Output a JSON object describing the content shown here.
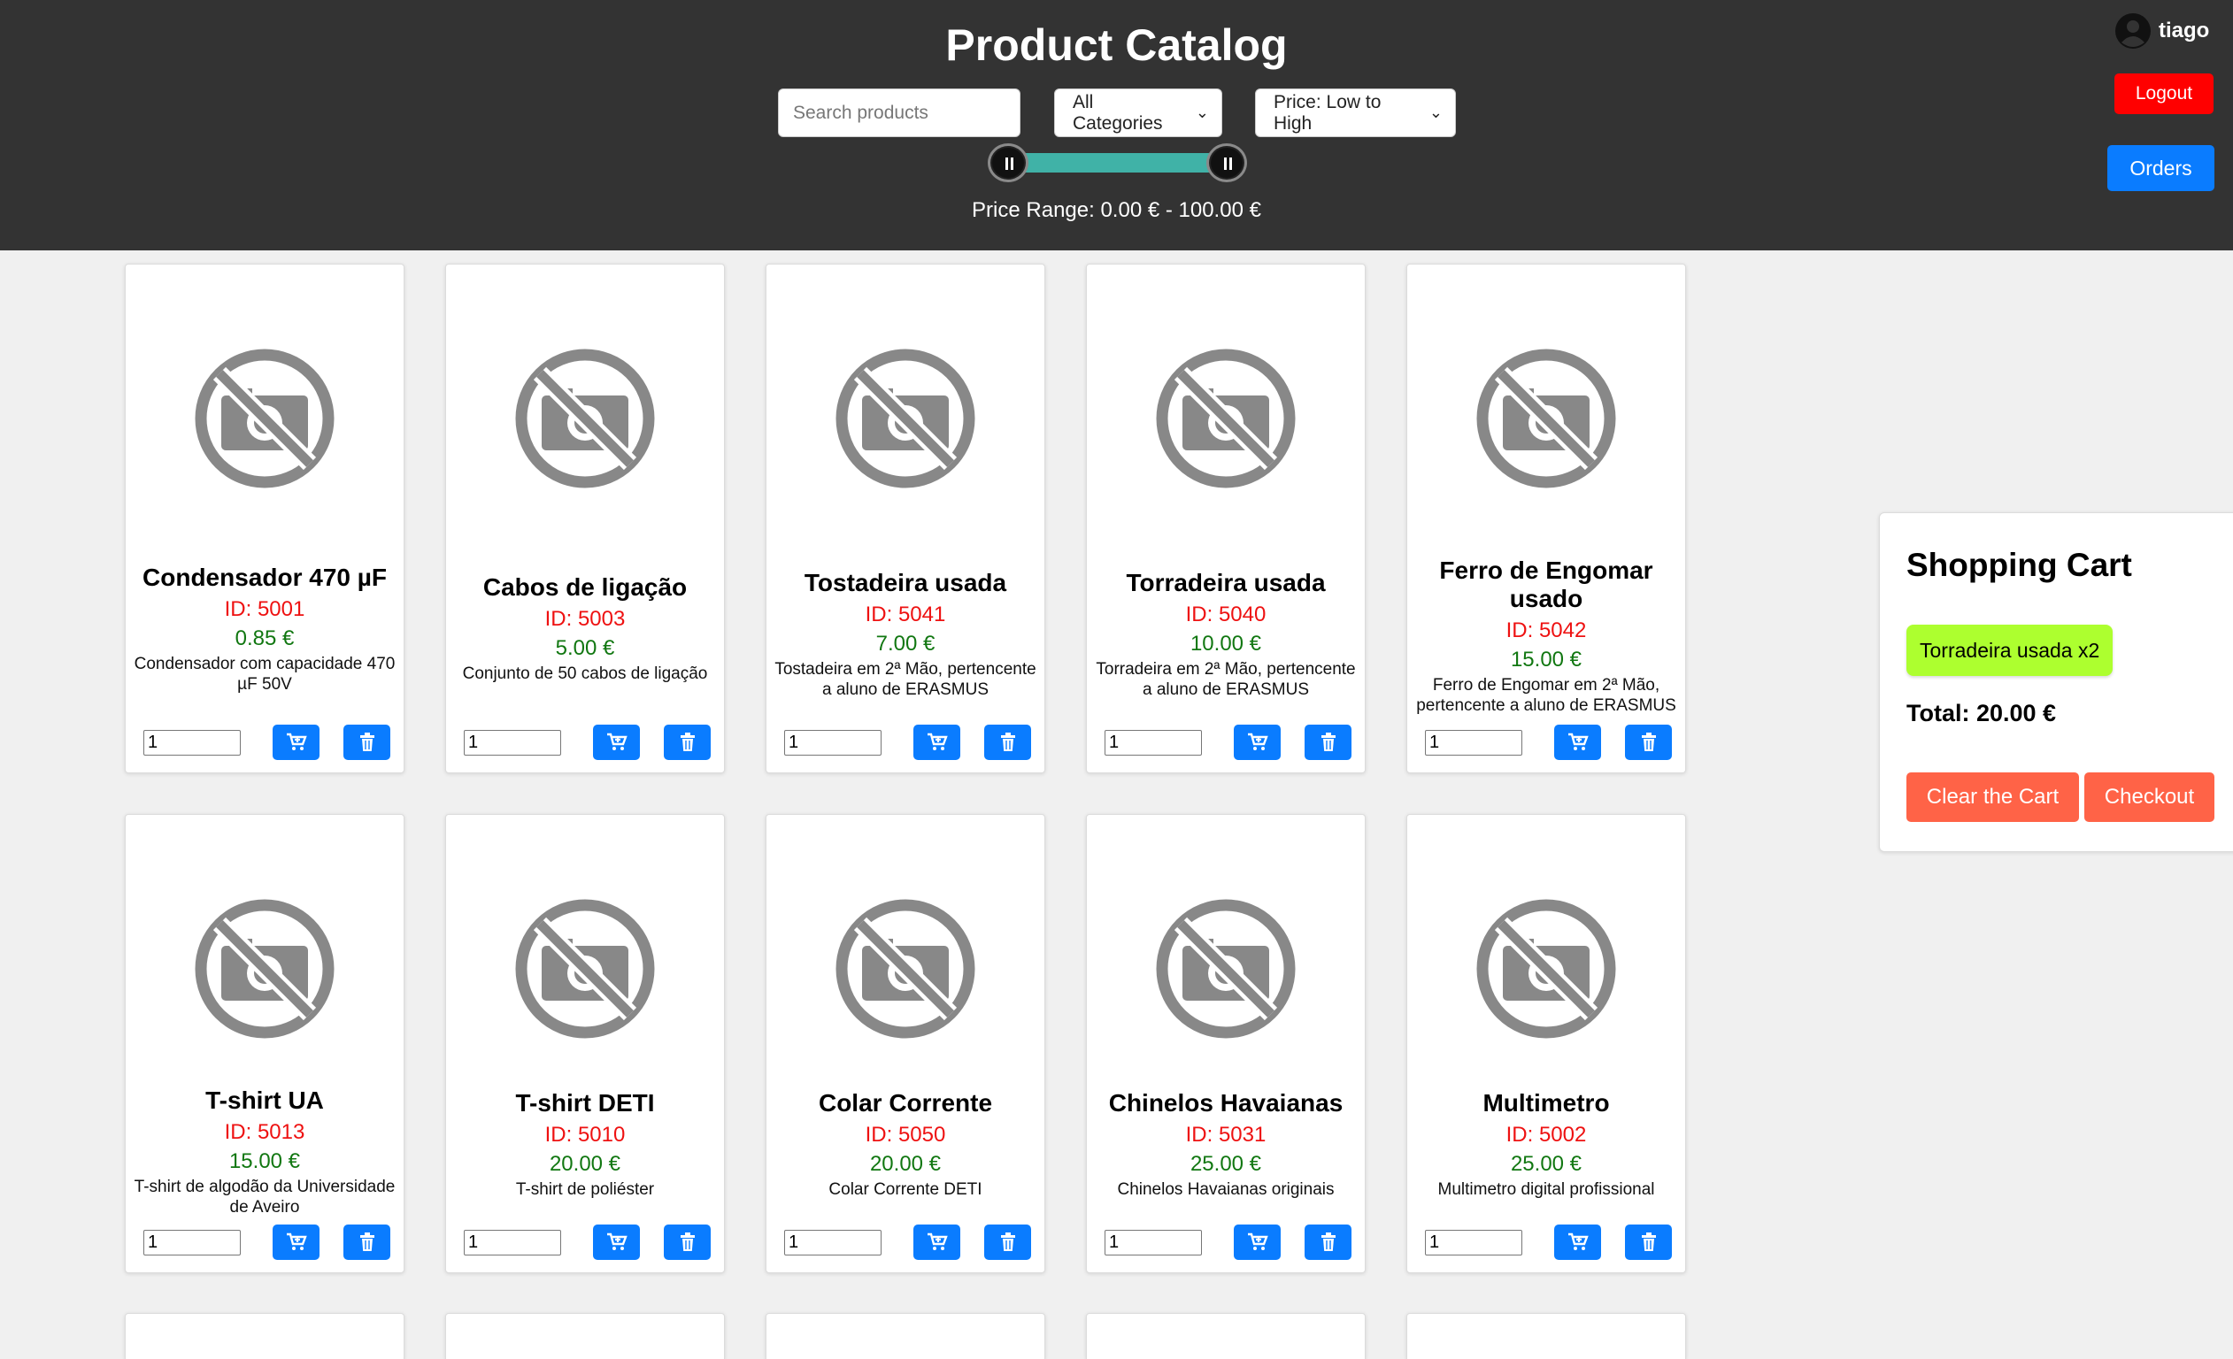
{
  "header": {
    "title": "Product Catalog",
    "search_placeholder": "Search products",
    "category_select": "All Categories",
    "sort_select": "Price: Low to High",
    "price_range_label": "Price Range: 0.00 € - 100.00 €",
    "price_range_min": 0,
    "price_range_max": 100,
    "username": "tiago",
    "logout_label": "Logout",
    "orders_label": "Orders"
  },
  "products": [
    {
      "name": "Condensador 470 µF",
      "id": "ID: 5001",
      "price": "0.85 €",
      "desc": "Condensador com capacidade 470 µF 50V",
      "qty": "1"
    },
    {
      "name": "Cabos de ligação",
      "id": "ID: 5003",
      "price": "5.00 €",
      "desc": "Conjunto de 50 cabos de ligação",
      "qty": "1"
    },
    {
      "name": "Tostadeira usada",
      "id": "ID: 5041",
      "price": "7.00 €",
      "desc": "Tostadeira em 2ª Mão, pertencente a aluno de ERASMUS",
      "qty": "1"
    },
    {
      "name": "Torradeira usada",
      "id": "ID: 5040",
      "price": "10.00 €",
      "desc": "Torradeira em 2ª Mão, pertencente a aluno de ERASMUS",
      "qty": "1"
    },
    {
      "name": "Ferro de Engomar usado",
      "id": "ID: 5042",
      "price": "15.00 €",
      "desc": "Ferro de Engomar em 2ª Mão, pertencente a aluno de ERASMUS",
      "qty": "1"
    },
    {
      "name": "T-shirt UA",
      "id": "ID: 5013",
      "price": "15.00 €",
      "desc": "T-shirt de algodão da Universidade de Aveiro",
      "qty": "1"
    },
    {
      "name": "T-shirt DETI",
      "id": "ID: 5010",
      "price": "20.00 €",
      "desc": "T-shirt de poliéster",
      "qty": "1"
    },
    {
      "name": "Colar Corrente",
      "id": "ID: 5050",
      "price": "20.00 €",
      "desc": "Colar Corrente DETI",
      "qty": "1"
    },
    {
      "name": "Chinelos Havaianas",
      "id": "ID: 5031",
      "price": "25.00 €",
      "desc": "Chinelos Havaianas originais",
      "qty": "1"
    },
    {
      "name": "Multimetro",
      "id": "ID: 5002",
      "price": "25.00 €",
      "desc": "Multimetro digital profissional",
      "qty": "1"
    }
  ],
  "cart": {
    "title": "Shopping Cart",
    "items": [
      "Torradeira usada x2"
    ],
    "total": "Total: 20.00 €",
    "clear_label": "Clear the Cart",
    "checkout_label": "Checkout"
  },
  "icons": {
    "no_image": "no-photo-icon",
    "add": "add-to-cart-icon",
    "delete": "trash-icon",
    "user": "user-icon"
  },
  "colors": {
    "header_bg": "#333333",
    "id_red": "#ee1111",
    "price_green": "#117711",
    "primary_blue": "#0a7cff",
    "logout_red": "#ff0000",
    "cart_item_bg": "#adff2f",
    "cart_button": "#ff6347",
    "range_fill": "#40b2a7"
  }
}
